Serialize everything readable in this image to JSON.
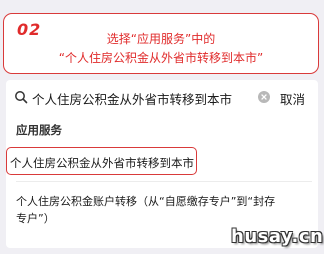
{
  "instruction": {
    "step_number": "02",
    "line1": "选择“应用服务”中的",
    "line2": "“个人住房公积金从外省市转移到本市”"
  },
  "search": {
    "query": "个人住房公积金从外省市转移到本市",
    "cancel_label": "取消"
  },
  "results": {
    "section_title": "应用服务",
    "items": [
      {
        "lines": [
          "个人住房公积金从外省市转移到本市"
        ]
      },
      {
        "lines": [
          "个人住房公积金账户转移（从“自愿缴存专户”到“封存",
          "专户”）"
        ]
      }
    ]
  },
  "watermark": "husay.cn",
  "colors": {
    "accent_red": "#e02b2b",
    "page_background": "#f0eff4"
  }
}
